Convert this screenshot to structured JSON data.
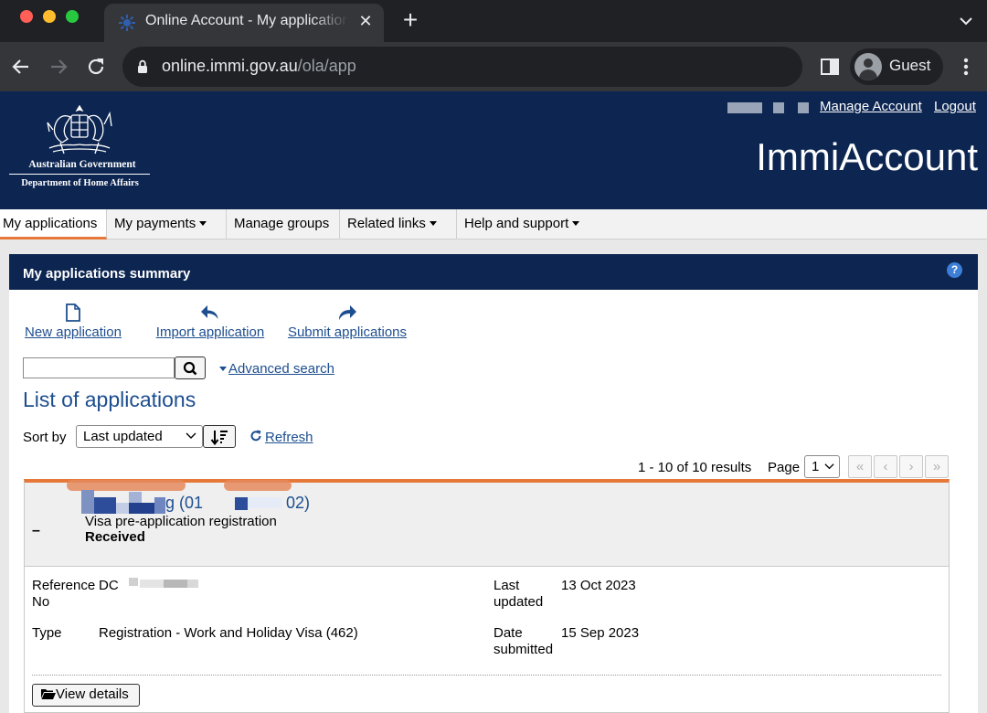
{
  "browser": {
    "tab_title": "Online Account - My applications",
    "tab_close": "✕",
    "new_tab": "+",
    "url_host": "online.immi.gov.au",
    "url_path": "/ola/app",
    "profile_label": "Guest"
  },
  "header": {
    "gov_line1": "Australian Government",
    "gov_line2": "Department of Home Affairs",
    "manage_account": "Manage Account",
    "logout": "Logout",
    "brand": "ImmiAccount"
  },
  "nav": {
    "items": [
      {
        "label": "My applications",
        "has_menu": false,
        "active": true
      },
      {
        "label": "My payments",
        "has_menu": true,
        "active": false
      },
      {
        "label": "Manage groups",
        "has_menu": false,
        "active": false
      },
      {
        "label": "Related links",
        "has_menu": true,
        "active": false
      },
      {
        "label": "Help and support",
        "has_menu": true,
        "active": false
      }
    ]
  },
  "panel": {
    "title": "My applications summary",
    "help": "?",
    "actions": {
      "new": "New application",
      "import": "Import application",
      "submit": "Submit applications"
    },
    "search_value": "",
    "advanced_search": "Advanced search",
    "list_title": "List of applications",
    "sort_by_label": "Sort by",
    "sort_value": "Last updated",
    "refresh": "Refresh",
    "results": "1 - 10 of 10 results",
    "page_label": "Page",
    "page_value": "1",
    "pager": [
      "«",
      "‹",
      "›",
      "»"
    ]
  },
  "application": {
    "name_visible_1": "g (01",
    "name_visible_2": "02)",
    "collapse": "–",
    "subtitle": "Visa pre-application registration",
    "status": "Received",
    "reference_label": "Reference No",
    "reference_value_prefix": "DC",
    "type_label": "Type",
    "type_value": "Registration - Work and Holiday Visa (462)",
    "last_updated_label": "Last updated",
    "last_updated_value": "13 Oct 2023",
    "date_submitted_label": "Date submitted",
    "date_submitted_value": "15 Sep 2023",
    "view_details": "View details"
  },
  "colors": {
    "gov_navy": "#0c2551",
    "link_blue": "#1d4e8f",
    "accent_orange": "#e6793a",
    "chrome_dark": "#202124",
    "chrome_mid": "#35363a"
  }
}
